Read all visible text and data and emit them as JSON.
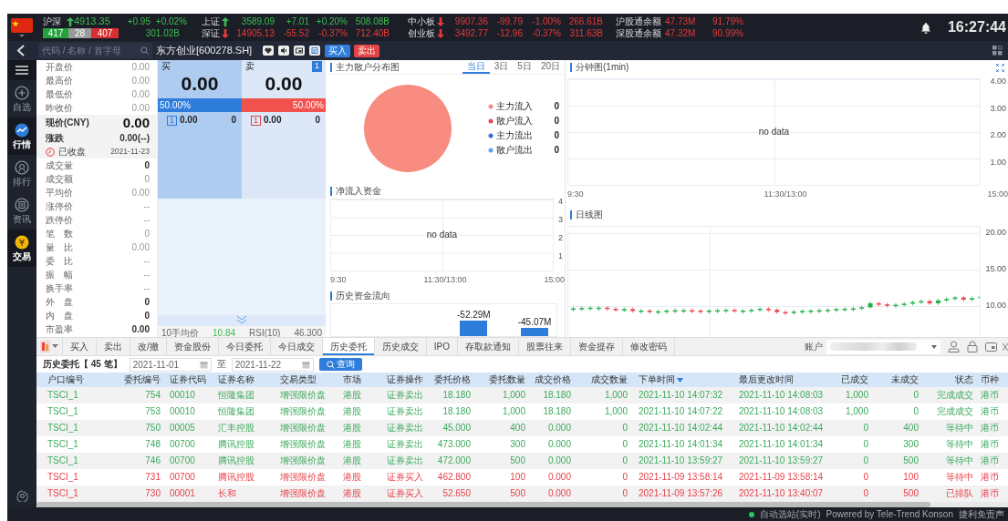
{
  "market": {
    "composite": {
      "name": "沪深",
      "kind": "up",
      "value": "4913.35",
      "change": "+0.95",
      "pct": "+0.02%",
      "amount": "301.02B",
      "up_count": "417",
      "flat_count": "28",
      "down_count": "407"
    },
    "indices": [
      {
        "name": "上证",
        "kind": "up",
        "value": "3589.09",
        "change": "+7.01",
        "pct": "+0.20%",
        "amount": "508.08B"
      },
      {
        "name": "深证",
        "kind": "down",
        "value": "14905.13",
        "change": "-55.52",
        "pct": "-0.37%",
        "amount": "712.40B"
      },
      {
        "name": "中小板",
        "kind": "down",
        "value": "9907.36",
        "change": "-99.79",
        "pct": "-1.00%",
        "amount": "266.61B"
      },
      {
        "name": "创业板",
        "kind": "down",
        "value": "3492.77",
        "change": "-12.96",
        "pct": "-0.37%",
        "amount": "311.63B"
      }
    ],
    "connect": [
      {
        "name": "沪股通余额",
        "amount": "47.73M",
        "pct": "91.79%"
      },
      {
        "name": "深股通余额",
        "amount": "47.32M",
        "pct": "90.99%"
      }
    ],
    "time": "16:27:44"
  },
  "toolbar": {
    "search_placeholder": "代码 / 名称 / 首字母",
    "stock": "东方创业[600278.SH]",
    "buy": "买入",
    "sell": "卖出"
  },
  "sidebar": [
    {
      "label": "自选",
      "selected": false
    },
    {
      "label": "行情",
      "selected": true
    },
    {
      "label": "排行",
      "selected": false
    },
    {
      "label": "资讯",
      "selected": false
    },
    {
      "label": "交易",
      "selected": true
    }
  ],
  "quote": [
    {
      "kind": "plain",
      "label": "开盘价",
      "value": "0.00"
    },
    {
      "kind": "plain",
      "label": "最高价",
      "value": "0.00"
    },
    {
      "kind": "plain",
      "label": "最低价",
      "value": "0.00"
    },
    {
      "kind": "plain",
      "label": "昨收价",
      "value": "0.00"
    },
    {
      "kind": "price",
      "label": "现价(CNY)",
      "value": "0.00"
    },
    {
      "kind": "change",
      "label": "涨跌",
      "value": "0.00(--)"
    },
    {
      "kind": "status",
      "label": "已收盘",
      "value": "2021-11-23"
    },
    {
      "kind": "strong",
      "label": "成交量",
      "value": "0"
    },
    {
      "kind": "plain",
      "label": "成交额",
      "value": "0"
    },
    {
      "kind": "plain",
      "label": "平均价",
      "value": "0.00"
    },
    {
      "kind": "plain",
      "label": "涨停价",
      "value": "--"
    },
    {
      "kind": "plain",
      "label": "跌停价",
      "value": "--"
    },
    {
      "kind": "plain",
      "label": "笔　数",
      "value": "0"
    },
    {
      "kind": "plain",
      "label": "量　比",
      "value": "0.00"
    },
    {
      "kind": "plain",
      "label": "委　比",
      "value": "--"
    },
    {
      "kind": "plain",
      "label": "振　幅",
      "value": "--"
    },
    {
      "kind": "plain",
      "label": "换手率",
      "value": "--"
    },
    {
      "kind": "strong",
      "label": "外　盘",
      "value": "0"
    },
    {
      "kind": "strong",
      "label": "内　盘",
      "value": "0"
    },
    {
      "kind": "strong",
      "label": "市盈率",
      "value": "0.00"
    }
  ],
  "orderbook": {
    "buy": {
      "label": "买",
      "price": "0.00",
      "pct": "50.00%",
      "rows": [
        {
          "index": "1",
          "price": "0.00",
          "volume": "0"
        }
      ]
    },
    "sell": {
      "label": "卖",
      "badge": "1",
      "price": "0.00",
      "pct": "50.00%",
      "rows": [
        {
          "index": "1",
          "price": "0.00",
          "volume": "0"
        }
      ]
    },
    "level": 0.5,
    "stats": [
      {
        "label": "10手均价",
        "value": "10.84"
      },
      {
        "label": "RSI(10)",
        "value": "46.300"
      }
    ]
  },
  "distribution": {
    "title": "主力散户分布图",
    "tabs": [
      {
        "label": "当日",
        "selected": true
      },
      {
        "label": "3日",
        "selected": false
      },
      {
        "label": "5日",
        "selected": false
      },
      {
        "label": "20日",
        "selected": false
      }
    ],
    "legend": [
      {
        "label": "主力流入",
        "value": "0",
        "color": "#f58a7e"
      },
      {
        "label": "散户流入",
        "value": "0",
        "color": "#ea4a48"
      },
      {
        "label": "主力流出",
        "value": "0",
        "color": "#2e72d8"
      },
      {
        "label": "散户流出",
        "value": "0",
        "color": "#5ea2f2"
      }
    ]
  },
  "net_inflow": {
    "title": "净流入资金",
    "empty": "no data",
    "yticks": [
      "4",
      "3",
      "2",
      "1"
    ],
    "xticks": [
      "9:30",
      "11:30/13:00",
      "15:00"
    ]
  },
  "history_flow": {
    "title": "历史资金流向",
    "bar_labels": [
      "-52.29M",
      "-45.07M"
    ]
  },
  "minute_chart": {
    "title": "分钟图(1min)",
    "empty": "no data",
    "yticks": [
      "4.00",
      "3.00",
      "2.00",
      "1.00"
    ],
    "xticks": [
      "9:30",
      "11:30/13:00",
      "15:00"
    ]
  },
  "daily_chart": {
    "title": "日线图",
    "yticks": [
      "20.00",
      "15.00",
      "10.00"
    ]
  },
  "trade": {
    "tabs": [
      {
        "label": "买入",
        "selected": false
      },
      {
        "label": "卖出",
        "selected": false
      },
      {
        "label": "改/撤",
        "selected": false
      },
      {
        "label": "资金股份",
        "selected": false
      },
      {
        "label": "今日委托",
        "selected": false
      },
      {
        "label": "今日成交",
        "selected": false
      },
      {
        "label": "历史委托",
        "selected": true
      },
      {
        "label": "历史成交",
        "selected": false
      },
      {
        "label": "IPO",
        "selected": false
      },
      {
        "label": "存取款通知",
        "selected": false
      },
      {
        "label": "股票往来",
        "selected": false
      },
      {
        "label": "资金提存",
        "selected": false
      },
      {
        "label": "修改密码",
        "selected": false
      }
    ],
    "account_label": "账户",
    "query_title": "历史委托【 45 笔】",
    "date_from": "2021-11-01",
    "date_sep": "至",
    "date_to": "2021-11-22",
    "query_button": "查询",
    "columns": [
      {
        "label": "户口编号",
        "sorted": false
      },
      {
        "label": "委托编号",
        "sorted": false
      },
      {
        "label": "证券代码",
        "sorted": false
      },
      {
        "label": "证券名称",
        "sorted": false
      },
      {
        "label": "交易类型",
        "sorted": false
      },
      {
        "label": "市场",
        "sorted": false
      },
      {
        "label": "证券操作",
        "sorted": false
      },
      {
        "label": "委托价格",
        "sorted": false
      },
      {
        "label": "委托数量",
        "sorted": false
      },
      {
        "label": "成交价格",
        "sorted": false
      },
      {
        "label": "成交数量",
        "sorted": false
      },
      {
        "label": "下单时间",
        "sorted": true
      },
      {
        "label": "最后更改时间",
        "sorted": false
      },
      {
        "label": "已成交",
        "sorted": false
      },
      {
        "label": "未成交",
        "sorted": false
      },
      {
        "label": "状态",
        "sorted": false
      },
      {
        "label": "币种",
        "sorted": false
      }
    ],
    "rows": [
      {
        "kind": "sell",
        "cells": [
          "TSCI_1",
          "754",
          "00010",
          "恒隆集团",
          "增强限价盘",
          "港股",
          "证券卖出",
          "18.180",
          "1,000",
          "18.180",
          "1,000",
          "2021-11-10 14:07:32",
          "2021-11-10 14:08:03",
          "1,000",
          "0",
          "完成成交",
          "港币"
        ]
      },
      {
        "kind": "sell",
        "cells": [
          "TSCI_1",
          "753",
          "00010",
          "恒隆集团",
          "增强限价盘",
          "港股",
          "证券卖出",
          "18.180",
          "1,000",
          "18.180",
          "1,000",
          "2021-11-10 14:07:22",
          "2021-11-10 14:08:03",
          "1,000",
          "0",
          "完成成交",
          "港币"
        ]
      },
      {
        "kind": "sell",
        "cells": [
          "TSCI_1",
          "750",
          "00005",
          "汇丰控股",
          "增强限价盘",
          "港股",
          "证券卖出",
          "45.000",
          "400",
          "0.000",
          "0",
          "2021-11-10 14:02:44",
          "2021-11-10 14:02:44",
          "0",
          "400",
          "等待中",
          "港币"
        ]
      },
      {
        "kind": "sell",
        "cells": [
          "TSCI_1",
          "748",
          "00700",
          "腾讯控股",
          "增强限价盘",
          "港股",
          "证券卖出",
          "473.000",
          "300",
          "0.000",
          "0",
          "2021-11-10 14:01:34",
          "2021-11-10 14:01:34",
          "0",
          "300",
          "等待中",
          "港币"
        ]
      },
      {
        "kind": "sell",
        "cells": [
          "TSCI_1",
          "746",
          "00700",
          "腾讯控股",
          "增强限价盘",
          "港股",
          "证券卖出",
          "472.000",
          "500",
          "0.000",
          "0",
          "2021-11-10 13:59:27",
          "2021-11-10 13:59:27",
          "0",
          "500",
          "等待中",
          "港币"
        ]
      },
      {
        "kind": "buy",
        "cells": [
          "TSCI_1",
          "731",
          "00700",
          "腾讯控股",
          "增强限价盘",
          "港股",
          "证券买入",
          "462.800",
          "100",
          "0.000",
          "0",
          "2021-11-09 13:58:14",
          "2021-11-09 13:58:14",
          "0",
          "100",
          "等待中",
          "港币"
        ]
      },
      {
        "kind": "buy",
        "cells": [
          "TSCI_1",
          "730",
          "00001",
          "长和",
          "增强限价盘",
          "港股",
          "证券买入",
          "52.650",
          "500",
          "0.000",
          "0",
          "2021-11-09 13:57:26",
          "2021-11-10 13:40:07",
          "0",
          "500",
          "已排队",
          "港币"
        ]
      }
    ]
  },
  "status_bar": {
    "site": "自动选站(实时)",
    "powered": "Powered by Tele-Trend Konson",
    "disclaimer": "捷利免责声"
  }
}
